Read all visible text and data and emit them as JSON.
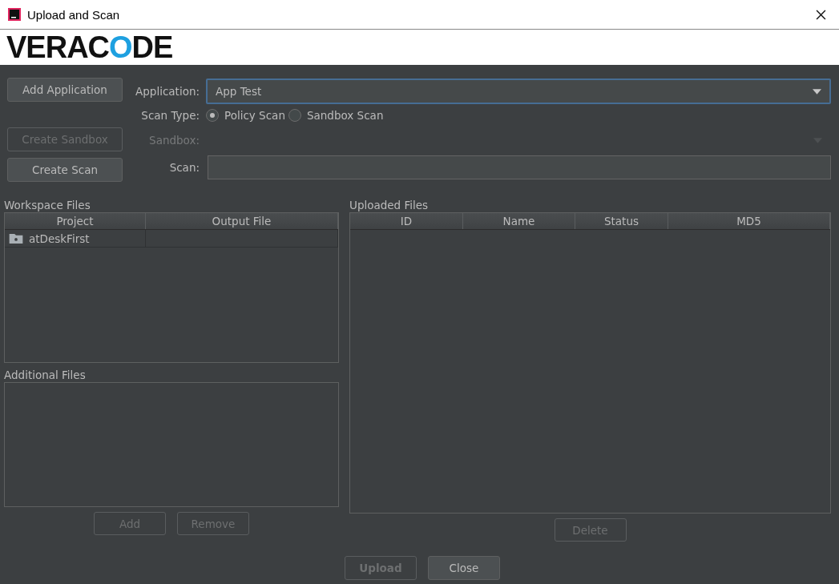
{
  "window": {
    "title": "Upload and Scan"
  },
  "logo": {
    "text_before": "VERAC",
    "text_accent": "O",
    "text_after": "DE"
  },
  "left_buttons": [
    {
      "label": "Add Application",
      "disabled": false
    },
    {
      "label": "Create Sandbox",
      "disabled": true
    },
    {
      "label": "Create Scan",
      "disabled": false
    }
  ],
  "application": {
    "label": "Application:",
    "value": "App Test"
  },
  "scan_type": {
    "label": "Scan Type:",
    "options": [
      {
        "label": "Policy Scan",
        "selected": true
      },
      {
        "label": "Sandbox Scan",
        "selected": false
      }
    ]
  },
  "sandbox": {
    "label": "Sandbox:",
    "disabled": true
  },
  "scan": {
    "label": "Scan:"
  },
  "workspace_files": {
    "title": "Workspace Files",
    "columns": [
      "Project",
      "Output File"
    ],
    "rows": [
      {
        "project": "atDeskFirst"
      }
    ]
  },
  "additional_files": {
    "title": "Additional Files",
    "buttons": [
      {
        "label": "Add",
        "disabled": true
      },
      {
        "label": "Remove",
        "disabled": true
      }
    ]
  },
  "uploaded_files": {
    "title": "Uploaded Files",
    "columns": [
      "ID",
      "Name",
      "Status",
      "MD5"
    ],
    "buttons": [
      {
        "label": "Delete",
        "disabled": true
      }
    ]
  },
  "footer_buttons": [
    {
      "label": "Upload",
      "disabled": true,
      "bold": true
    },
    {
      "label": "Close",
      "disabled": false,
      "bold": false
    }
  ]
}
